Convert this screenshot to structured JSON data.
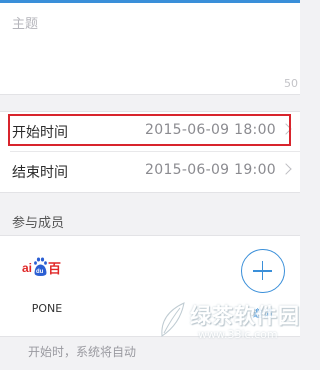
{
  "subject": {
    "placeholder": "主题",
    "char_count": "50"
  },
  "times": {
    "start_label": "开始时间",
    "start_value": "2015-06-09 18:00",
    "end_label": "结束时间",
    "end_value": "2015-06-09 19:00",
    "highlight_color": "#d8242c"
  },
  "members": {
    "section_title": "参与成员",
    "items": [
      {
        "name": "PONE",
        "logo_text": "百"
      }
    ],
    "invite_label": "邀请",
    "accent_color": "#3a8fd9"
  },
  "notice": "开始时，系统将自动",
  "watermark": {
    "text": "绿茶软件园",
    "url": "www.33lc.com"
  }
}
